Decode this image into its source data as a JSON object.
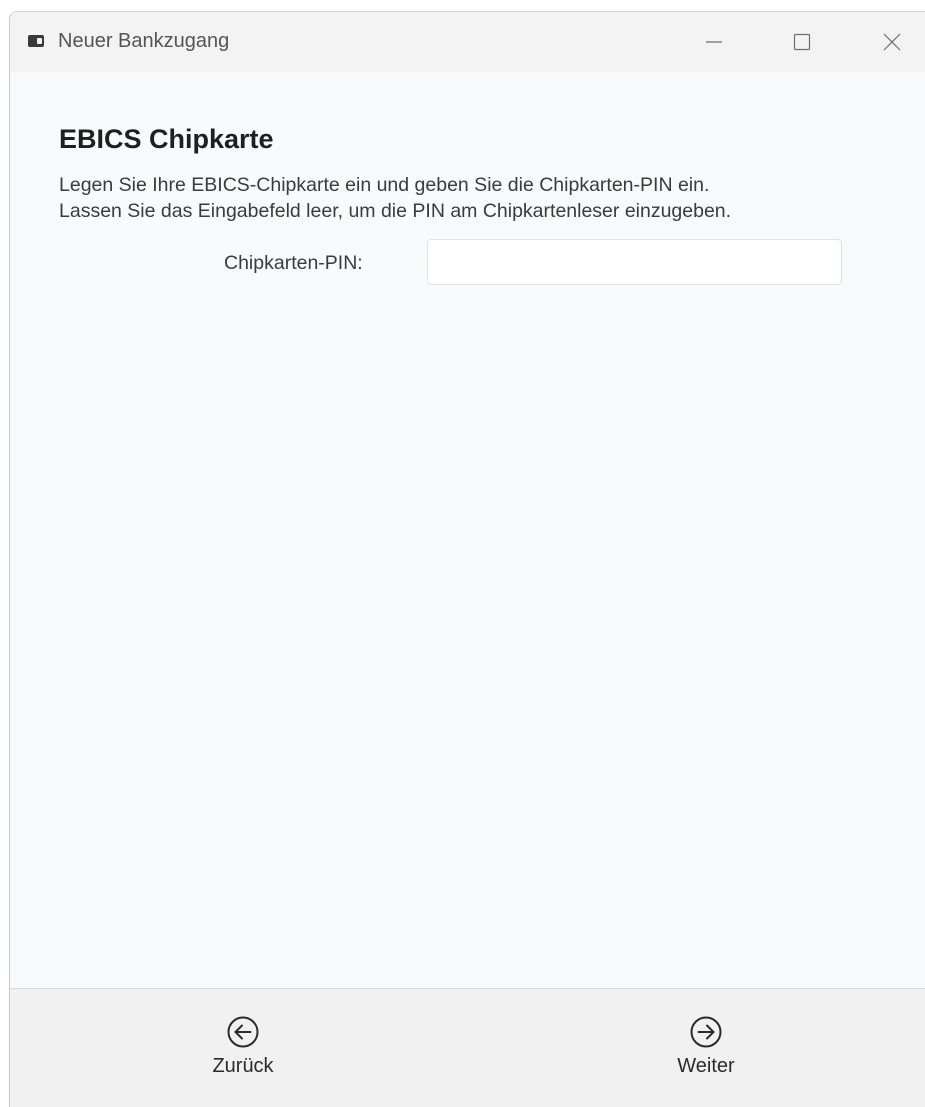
{
  "window": {
    "title": "Neuer Bankzugang",
    "app_icon": "card-reader-icon",
    "controls": {
      "minimize_icon": "minimize-icon",
      "maximize_icon": "maximize-icon",
      "close_icon": "close-icon"
    }
  },
  "main": {
    "heading": "EBICS Chipkarte",
    "description_line1": "Legen Sie Ihre EBICS-Chipkarte ein und geben Sie die Chipkarten-PIN ein.",
    "description_line2": "Lassen Sie das Eingabefeld leer, um die PIN am Chipkartenleser einzugeben.",
    "pin_label": "Chipkarten-PIN:",
    "pin_value": ""
  },
  "footer": {
    "back_label": "Zurück",
    "back_icon": "arrow-left-circle-icon",
    "next_label": "Weiter",
    "next_icon": "arrow-right-circle-icon"
  }
}
